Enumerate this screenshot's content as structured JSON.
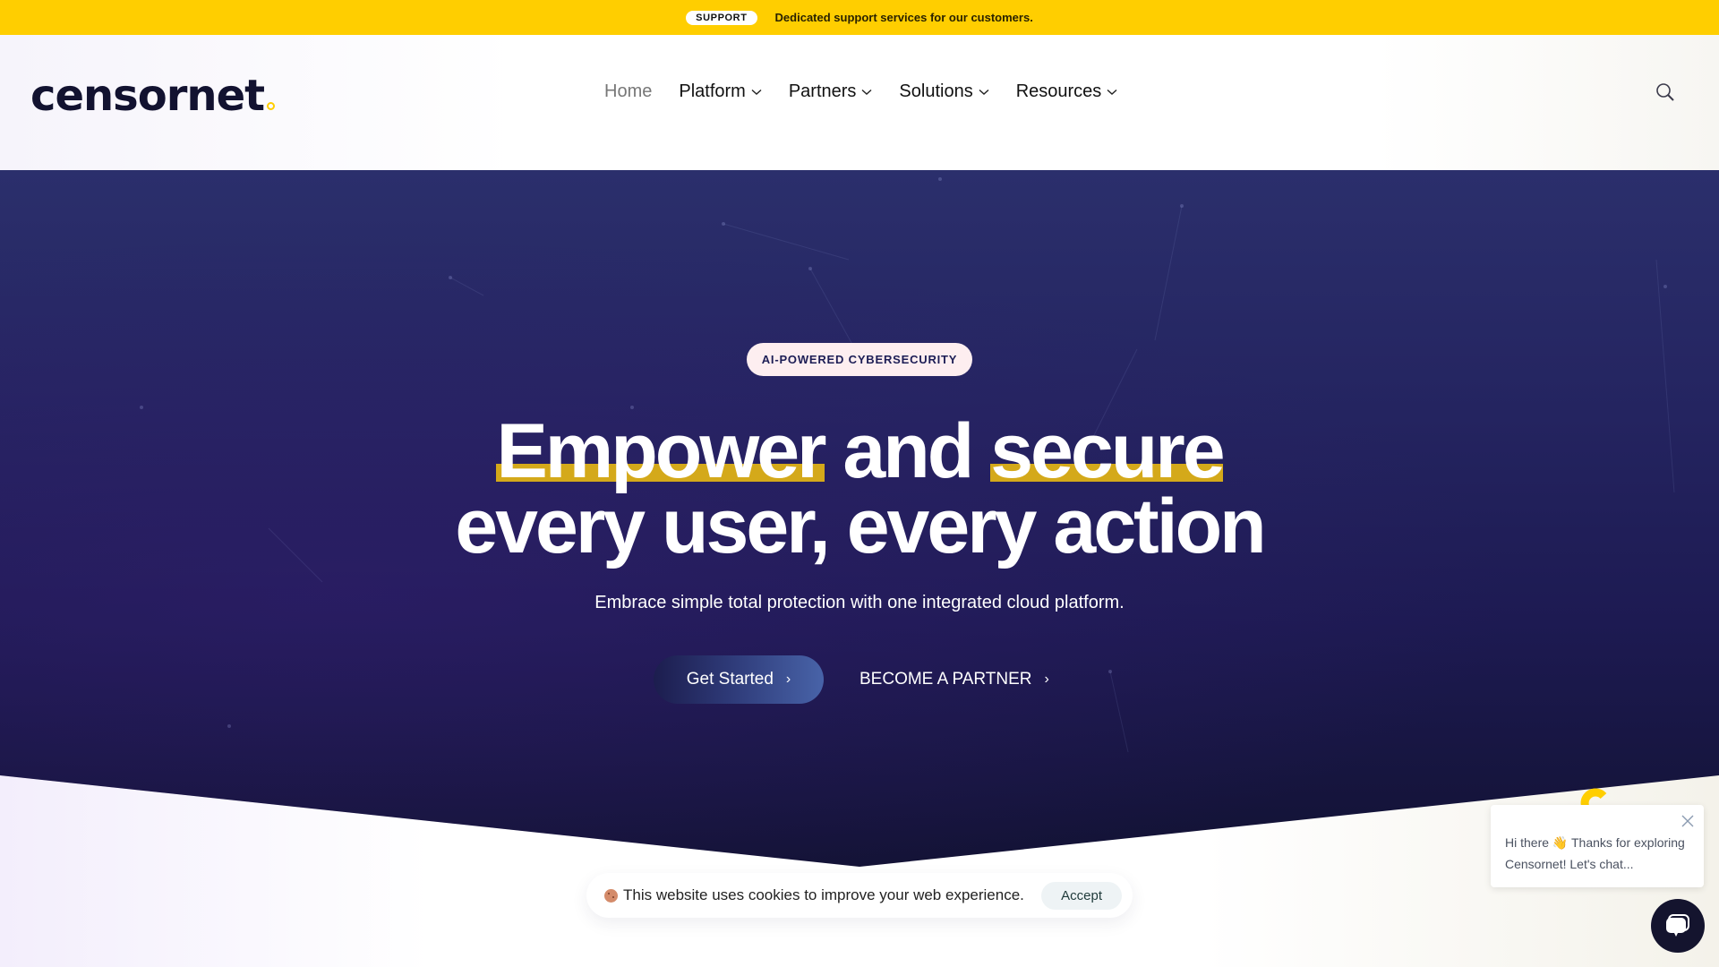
{
  "topbar": {
    "badge": "SUPPORT",
    "message": "Dedicated support services for our customers.",
    "background": "#FFCE00"
  },
  "header": {
    "logo": "censornet",
    "nav": [
      {
        "label": "Home",
        "dropdown": false,
        "active": true
      },
      {
        "label": "Platform",
        "dropdown": true
      },
      {
        "label": "Partners",
        "dropdown": true
      },
      {
        "label": "Solutions",
        "dropdown": true
      },
      {
        "label": "Resources",
        "dropdown": true
      }
    ],
    "search_icon": "search-icon"
  },
  "hero": {
    "tag": "AI-POWERED CYBERSECURITY",
    "headline": {
      "line1_word1": "Empower",
      "line1_mid": " and ",
      "line1_word2": "secure",
      "line2": "every user, every action"
    },
    "subtitle": "Embrace simple total protection with one integrated cloud platform.",
    "primary_button": "Get Started",
    "secondary_button": "BECOME A PARTNER",
    "arrow": "›",
    "highlight_color": "#D4A91A"
  },
  "cookie_banner": {
    "icon": "cookie-icon",
    "text": "This website uses cookies to improve your web experience.",
    "accept_label": "Accept"
  },
  "chat": {
    "message": "Hi there 👋 Thanks for exploring Censornet! Let's chat...",
    "close_icon": "close-icon",
    "launcher_icon": "chat-bubble-icon"
  }
}
